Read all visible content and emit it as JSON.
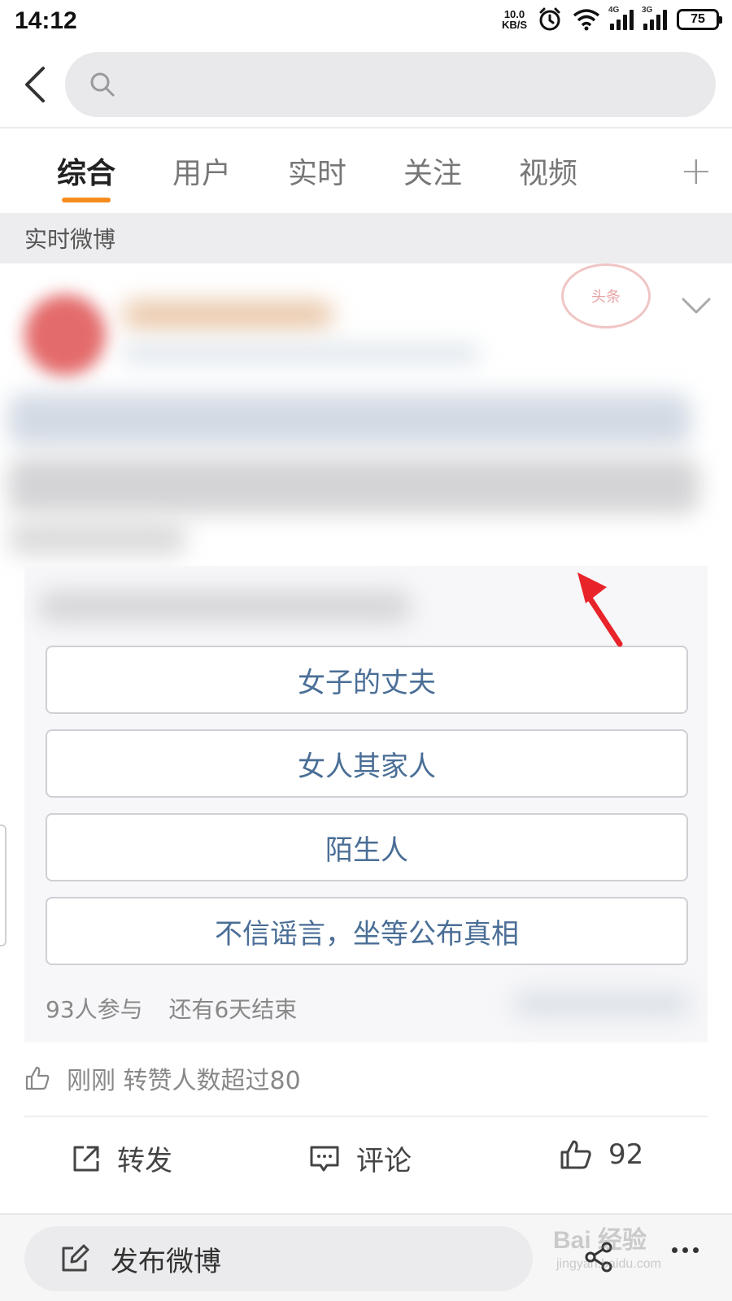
{
  "status_bar": {
    "time": "14:12",
    "net_speed_value": "10.0",
    "net_speed_unit": "KB/S",
    "signal_1_label": "4G",
    "signal_2_label": "3G",
    "battery": "75"
  },
  "search": {
    "placeholder": "",
    "value": ""
  },
  "tabs": [
    {
      "label": "综合",
      "active": true
    },
    {
      "label": "用户",
      "active": false
    },
    {
      "label": "实时",
      "active": false
    },
    {
      "label": "关注",
      "active": false
    },
    {
      "label": "视频",
      "active": false
    }
  ],
  "tab_add": "+",
  "section_header": "实时微博",
  "stamp_text": "头条",
  "poll": {
    "options": [
      {
        "label": "女子的丈夫"
      },
      {
        "label": "女人其家人"
      },
      {
        "label": "陌生人"
      },
      {
        "label": "不信谣言，坐等公布真相"
      }
    ],
    "participants": "93人参与",
    "remaining": "还有6天结束"
  },
  "reason": "刚刚 转赞人数超过80",
  "actions": {
    "repost": "转发",
    "comment": "评论",
    "like_count": "92"
  },
  "bottom_bar": {
    "compose_label": "发布微博"
  },
  "watermark": {
    "main": "Bai 经验",
    "sub": "jingyan.baidu.com"
  },
  "colors": {
    "accent_underline": "#f78c1e",
    "poll_option_text": "#4a6e96",
    "annotation_arrow": "#e8242a"
  }
}
